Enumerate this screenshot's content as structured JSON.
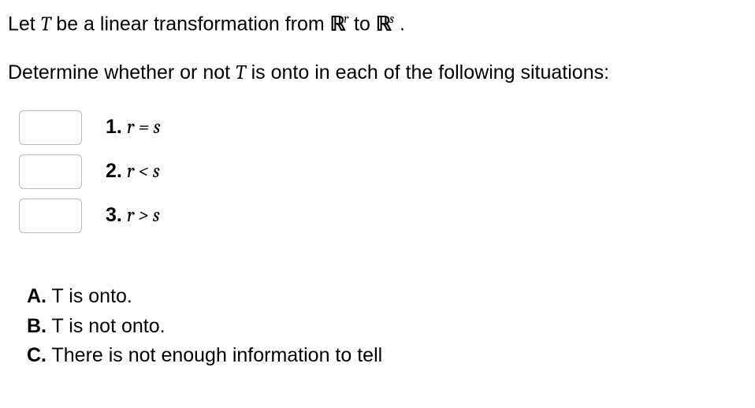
{
  "intro_prefix": "Let ",
  "intro_T": "T",
  "intro_mid1": " be a linear transformation from ",
  "intro_R1": "ℝ",
  "intro_exp1": "r",
  "intro_to": " to ",
  "intro_R2": "ℝ",
  "intro_exp2": "s",
  "intro_end": " .",
  "prompt_prefix": "Determine whether or not ",
  "prompt_T": "T",
  "prompt_suffix": " is onto in each of the following situations:",
  "items": {
    "0": {
      "num": "1.",
      "expr": "r = s"
    },
    "1": {
      "num": "2.",
      "expr": "r < s"
    },
    "2": {
      "num": "3.",
      "expr": "r > s"
    }
  },
  "options": {
    "0": {
      "letter": "A.",
      "text": " T is onto."
    },
    "1": {
      "letter": "B.",
      "text": " T is not onto."
    },
    "2": {
      "letter": "C.",
      "text": " There is not enough information to tell"
    }
  }
}
